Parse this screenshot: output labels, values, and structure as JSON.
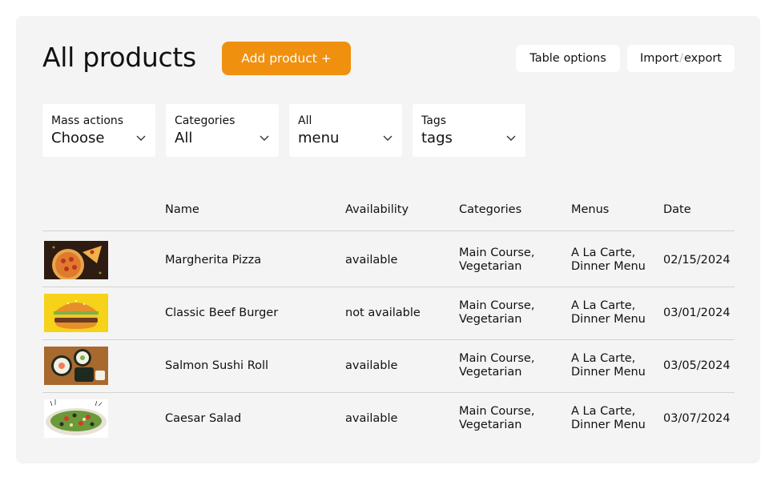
{
  "header": {
    "title": "All products",
    "add_button": "Add product +",
    "table_options": "Table options",
    "import_label": "Import",
    "import_sep": "/",
    "export_label": "export"
  },
  "filters": [
    {
      "label": "Mass actions",
      "value": "Choose"
    },
    {
      "label": "Categories",
      "value": "All"
    },
    {
      "label": "All",
      "value": "menu"
    },
    {
      "label": "Tags",
      "value": "tags"
    }
  ],
  "table": {
    "columns": [
      "Name",
      "Availability",
      "Categories",
      "Menus",
      "Date"
    ],
    "rows": [
      {
        "thumb": "pizza",
        "name": "Margherita Pizza",
        "availability": "available",
        "categories": [
          "Main Course,",
          "Vegetarian"
        ],
        "menus": [
          "A La Carte,",
          "Dinner Menu"
        ],
        "date": "02/15/2024"
      },
      {
        "thumb": "burger",
        "name": "Classic Beef Burger",
        "availability": "not available",
        "categories": [
          "Main Course,",
          "Vegetarian"
        ],
        "menus": [
          "A La Carte,",
          "Dinner Menu"
        ],
        "date": "03/01/2024"
      },
      {
        "thumb": "sushi",
        "name": "Salmon Sushi Roll",
        "availability": "available",
        "categories": [
          "Main Course,",
          "Vegetarian"
        ],
        "menus": [
          "A La Carte,",
          "Dinner Menu"
        ],
        "date": "03/05/2024"
      },
      {
        "thumb": "salad",
        "name": "Caesar Salad",
        "availability": "available",
        "categories": [
          "Main Course,",
          "Vegetarian"
        ],
        "menus": [
          "A La Carte,",
          "Dinner Menu"
        ],
        "date": "03/07/2024"
      }
    ]
  },
  "colors": {
    "accent": "#f0900f",
    "panel": "#f4f4f4"
  }
}
